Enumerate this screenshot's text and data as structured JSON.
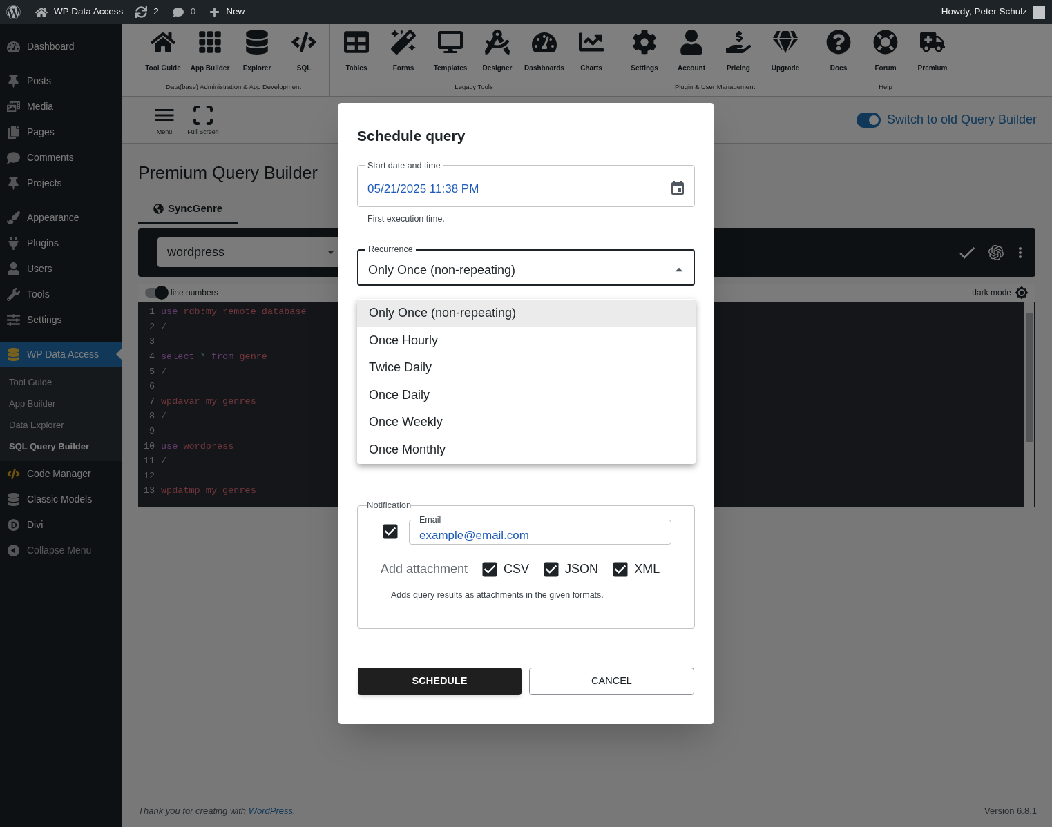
{
  "admin_bar": {
    "site": "WP Data Access",
    "updates": "2",
    "comments": "0",
    "new": "New",
    "greeting": "Howdy, Peter Schulz"
  },
  "sidebar": {
    "groups": [
      {
        "items": [
          {
            "label": "Dashboard",
            "selected": false
          }
        ]
      },
      {
        "items": [
          {
            "label": "Posts",
            "selected": false
          },
          {
            "label": "Media",
            "selected": false
          },
          {
            "label": "Pages",
            "selected": false
          },
          {
            "label": "Comments",
            "selected": false
          },
          {
            "label": "Projects",
            "selected": false
          }
        ]
      },
      {
        "items": [
          {
            "label": "Appearance",
            "selected": false
          },
          {
            "label": "Plugins",
            "selected": false
          },
          {
            "label": "Users",
            "selected": false
          },
          {
            "label": "Tools",
            "selected": false
          },
          {
            "label": "Settings",
            "selected": false
          }
        ]
      },
      {
        "items": [
          {
            "label": "WP Data Access",
            "selected": true,
            "children": [
              {
                "label": "Tool Guide",
                "selected": false
              },
              {
                "label": "App Builder",
                "selected": false
              },
              {
                "label": "Data Explorer",
                "selected": false
              },
              {
                "label": "SQL Query Builder",
                "selected": true
              }
            ]
          },
          {
            "label": "Code Manager",
            "selected": false
          },
          {
            "label": "Classic Models",
            "selected": false
          },
          {
            "label": "Divi",
            "selected": false
          },
          {
            "label": "Collapse Menu",
            "selected": false,
            "kind": "collapse"
          }
        ]
      }
    ]
  },
  "toolbar": {
    "groups": [
      {
        "label": "Data(base) Administration & App Development",
        "tools": [
          "Tool Guide",
          "App Builder",
          "Explorer",
          "SQL"
        ]
      },
      {
        "label": "Legacy Tools",
        "tools": [
          "Tables",
          "Forms",
          "Templates",
          "Designer",
          "Dashboards",
          "Charts"
        ]
      },
      {
        "label": "Plugin & User Management",
        "tools": [
          "Settings",
          "Account",
          "Pricing",
          "Upgrade"
        ]
      },
      {
        "label": "Help",
        "tools": [
          "Docs",
          "Forum",
          "Premium"
        ]
      }
    ]
  },
  "secondary_bar": {
    "buttons": [
      "Menu",
      "Full Screen"
    ],
    "switch": {
      "label": "Switch to old Query Builder",
      "on": true
    }
  },
  "page_title": "Premium Query Builder",
  "tabs": [
    {
      "label": "SyncGenre",
      "selected": true
    }
  ],
  "database_select": {
    "value": "wordpress"
  },
  "editor": {
    "line_numbers": {
      "label": "line numbers",
      "on": true
    },
    "dark_mode": {
      "label": "dark mode"
    },
    "lines": [
      {
        "number": "1",
        "tokens": [
          {
            "kind": "keyword",
            "text": "use"
          },
          {
            "kind": "value",
            "text": "rdb:my_remote_database"
          }
        ]
      },
      {
        "number": "2",
        "tokens": [
          {
            "kind": "plain",
            "text": "/"
          }
        ]
      },
      {
        "number": "3"
      },
      {
        "number": "4",
        "tokens": [
          {
            "kind": "keyword",
            "text": "select"
          },
          {
            "kind": "operator",
            "text": "*"
          },
          {
            "kind": "keyword",
            "text": "from"
          },
          {
            "kind": "value",
            "text": "genre"
          }
        ]
      },
      {
        "number": "5",
        "tokens": [
          {
            "kind": "plain",
            "text": "/"
          }
        ]
      },
      {
        "number": "6"
      },
      {
        "number": "7",
        "tokens": [
          {
            "kind": "value",
            "text": "wpdavar"
          },
          {
            "kind": "value",
            "text": "my_genres"
          }
        ]
      },
      {
        "number": "8",
        "tokens": [
          {
            "kind": "plain",
            "text": "/"
          }
        ]
      },
      {
        "number": "9"
      },
      {
        "number": "10",
        "tokens": [
          {
            "kind": "keyword",
            "text": "use"
          },
          {
            "kind": "value",
            "text": "wordpress"
          }
        ]
      },
      {
        "number": "11",
        "tokens": [
          {
            "kind": "plain",
            "text": "/"
          }
        ]
      },
      {
        "number": "12"
      },
      {
        "number": "13",
        "tokens": [
          {
            "kind": "value",
            "text": "wpdatmp"
          },
          {
            "kind": "value",
            "text": "my_genres"
          }
        ]
      }
    ]
  },
  "footer": {
    "text": "Thank you for creating with",
    "link": "WordPress",
    "after": ".",
    "version": "Version 6.8.1"
  },
  "modal": {
    "title": "Schedule query",
    "start": {
      "label": "Start date and time",
      "value": "05/21/2025 11:38 PM",
      "helper": "First execution time."
    },
    "recurrence": {
      "label": "Recurrence",
      "value": "Only Once (non-repeating)",
      "expanded": true,
      "options": [
        {
          "label": "Only Once (non-repeating)",
          "selected": true
        },
        {
          "label": "Once Hourly",
          "selected": false
        },
        {
          "label": "Twice Daily",
          "selected": false
        },
        {
          "label": "Once Daily",
          "selected": false
        },
        {
          "label": "Once Weekly",
          "selected": false
        },
        {
          "label": "Once Monthly",
          "selected": false
        }
      ]
    },
    "notification": {
      "legend": "Notification",
      "checked": true,
      "email": {
        "label": "Email",
        "value": "example@email.com"
      },
      "attachment_label": "Add attachment",
      "formats": [
        {
          "label": "CSV",
          "checked": true
        },
        {
          "label": "JSON",
          "checked": true
        },
        {
          "label": "XML",
          "checked": true
        }
      ],
      "helper": "Adds query results as attachments in the given formats."
    },
    "buttons": [
      {
        "label": "SCHEDULE",
        "kind": "primary"
      },
      {
        "label": "CANCEL",
        "kind": "secondary"
      }
    ]
  }
}
